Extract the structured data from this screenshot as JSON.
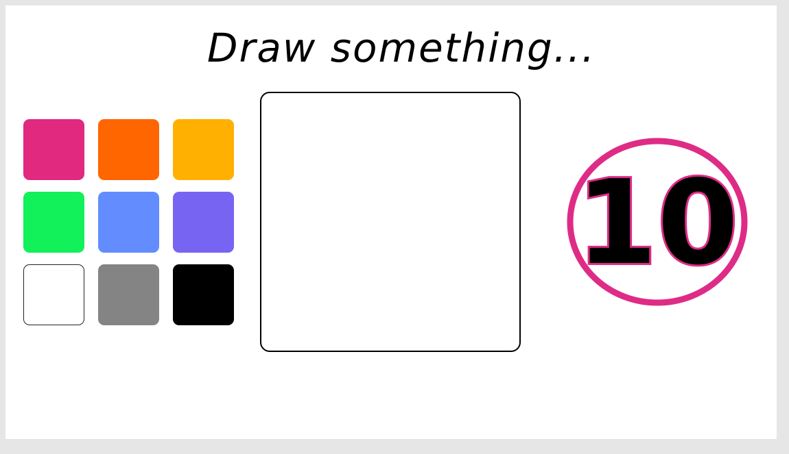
{
  "prompt": "Draw something...",
  "palette": [
    {
      "name": "pink",
      "color": "#E0297F"
    },
    {
      "name": "orange",
      "color": "#FF6600"
    },
    {
      "name": "yellow",
      "color": "#FFB000"
    },
    {
      "name": "green",
      "color": "#12F05A"
    },
    {
      "name": "blue",
      "color": "#638DFF"
    },
    {
      "name": "purple",
      "color": "#7864F2"
    },
    {
      "name": "white",
      "color": "#FFFFFF"
    },
    {
      "name": "gray",
      "color": "#848484"
    },
    {
      "name": "black",
      "color": "#000000"
    }
  ],
  "timer": {
    "value": "10",
    "ring_color": "#DE2C86",
    "digit_color": "#000000"
  }
}
